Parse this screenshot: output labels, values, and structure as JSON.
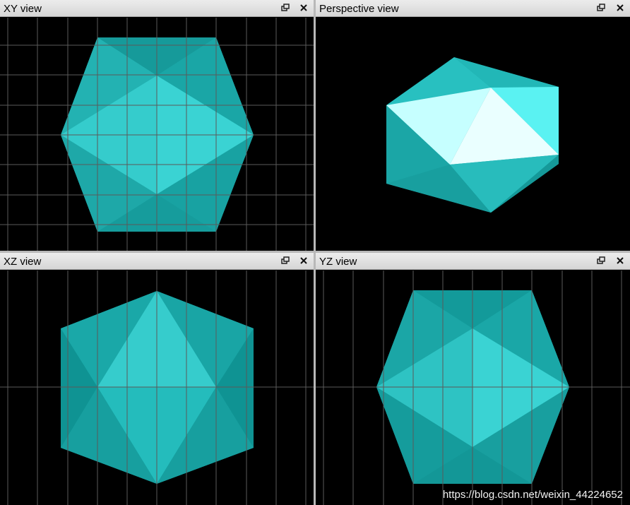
{
  "panes": {
    "xy": {
      "title": "XY view"
    },
    "persp": {
      "title": "Perspective view"
    },
    "xz": {
      "title": "XZ view"
    },
    "yz": {
      "title": "YZ view"
    }
  },
  "icons": {
    "restore": "restore-window-icon",
    "close": "close-icon"
  },
  "colors": {
    "background": "#000000",
    "grid": "#5a5a5a",
    "mesh": "#20b0b0",
    "mesh_light": "#3ad0d0"
  },
  "watermark": "https://blog.csdn.net/weixin_44224652"
}
